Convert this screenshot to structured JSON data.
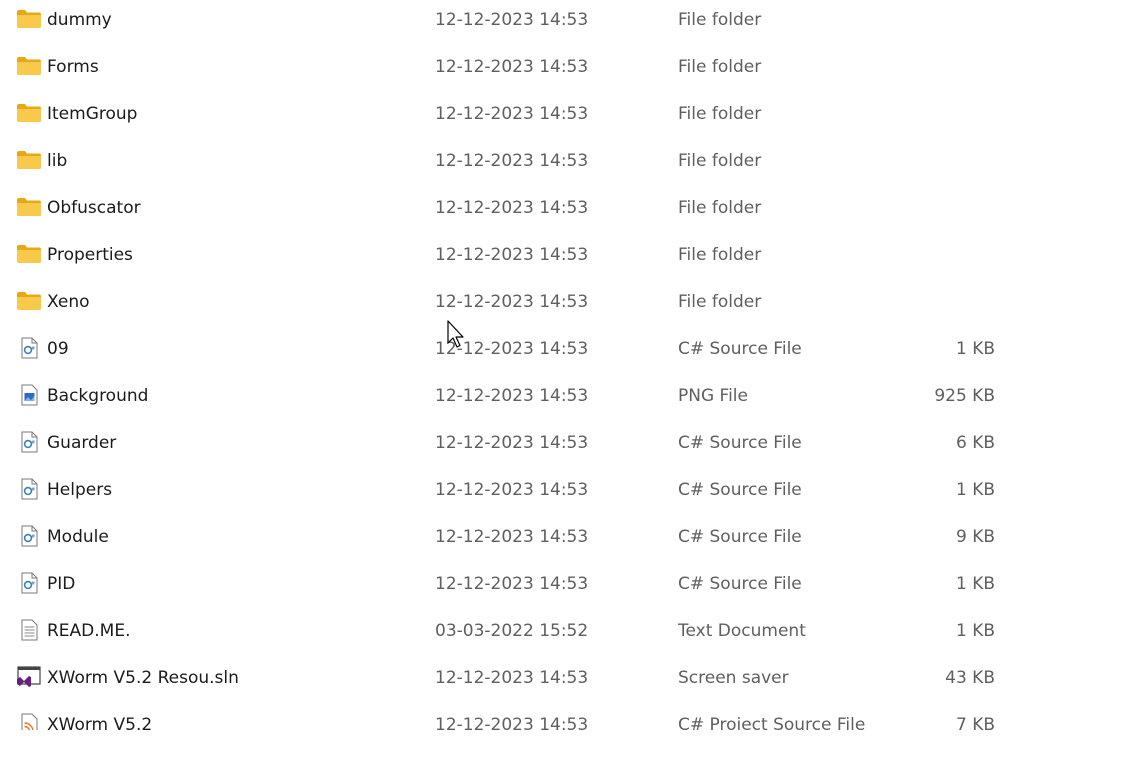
{
  "rows": [
    {
      "name": "dummy",
      "date": "12-12-2023 14:53",
      "type": "File folder",
      "size": "",
      "icon": "folder-icon"
    },
    {
      "name": "Forms",
      "date": "12-12-2023 14:53",
      "type": "File folder",
      "size": "",
      "icon": "folder-icon"
    },
    {
      "name": "ItemGroup",
      "date": "12-12-2023 14:53",
      "type": "File folder",
      "size": "",
      "icon": "folder-icon"
    },
    {
      "name": "lib",
      "date": "12-12-2023 14:53",
      "type": "File folder",
      "size": "",
      "icon": "folder-icon"
    },
    {
      "name": "Obfuscator",
      "date": "12-12-2023 14:53",
      "type": "File folder",
      "size": "",
      "icon": "folder-icon"
    },
    {
      "name": "Properties",
      "date": "12-12-2023 14:53",
      "type": "File folder",
      "size": "",
      "icon": "folder-icon"
    },
    {
      "name": "Xeno",
      "date": "12-12-2023 14:53",
      "type": "File folder",
      "size": "",
      "icon": "folder-icon"
    },
    {
      "name": "09",
      "date": "12-12-2023 14:53",
      "type": "C# Source File",
      "size": "1 KB",
      "icon": "csharp-file-icon"
    },
    {
      "name": "Background",
      "date": "12-12-2023 14:53",
      "type": "PNG File",
      "size": "925 KB",
      "icon": "image-file-icon"
    },
    {
      "name": "Guarder",
      "date": "12-12-2023 14:53",
      "type": "C# Source File",
      "size": "6 KB",
      "icon": "csharp-file-icon"
    },
    {
      "name": "Helpers",
      "date": "12-12-2023 14:53",
      "type": "C# Source File",
      "size": "1 KB",
      "icon": "csharp-file-icon"
    },
    {
      "name": "Module",
      "date": "12-12-2023 14:53",
      "type": "C# Source File",
      "size": "9 KB",
      "icon": "csharp-file-icon"
    },
    {
      "name": "PID",
      "date": "12-12-2023 14:53",
      "type": "C# Source File",
      "size": "1 KB",
      "icon": "csharp-file-icon"
    },
    {
      "name": "READ.ME.",
      "date": "03-03-2022 15:52",
      "type": "Text Document",
      "size": "1 KB",
      "icon": "text-file-icon"
    },
    {
      "name": "XWorm V5.2 Resou.sln",
      "date": "12-12-2023 14:53",
      "type": "Screen saver",
      "size": "43 KB",
      "icon": "visual-studio-solution-icon"
    },
    {
      "name": "XWorm V5.2",
      "date": "12-12-2023 14:53",
      "type": "C# Project Source File",
      "size": "7 KB",
      "icon": "rss-file-icon"
    }
  ],
  "colors": {
    "folder": "#f8c94a",
    "folder_dark": "#e6a817",
    "text": "#1b1b1b",
    "muted": "#5f5f5f",
    "vs_purple": "#68217a",
    "rss_orange": "#e07a1f"
  }
}
